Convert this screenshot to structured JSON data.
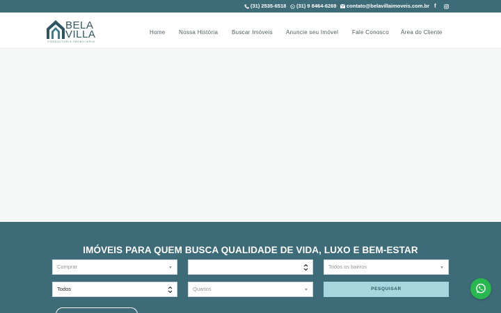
{
  "topbar": {
    "phone": "(31) 2535-6518",
    "whatsapp": "(31) 9 8464-6269",
    "email": "contato@belavillaimoveis.com.br",
    "facebook_glyph": "f"
  },
  "logo": {
    "line1": "BELA",
    "line2": "VILLA",
    "tagline": "CONSULTORIA IMOBILIÁRIA"
  },
  "nav": {
    "items": [
      "Home",
      "Nossa História",
      "Buscar Imóveis",
      "Anuncie seu Imóvel",
      "Fale Conosco",
      "Área do Cliente"
    ]
  },
  "search": {
    "heading": "IMÓVEIS PARA QUEM BUSCA QUALIDADE DE VIDA, LUXO E BEM-ESTAR",
    "purpose_placeholder": "Comprar",
    "city_value": "",
    "neighborhood_placeholder": "Todos os bairros",
    "type_value": "Todos",
    "rooms_placeholder": "Quartos",
    "submit_label": "PESQUISAR"
  },
  "colors": {
    "brand_teal": "#3d6b78",
    "button_light": "#a6d7df",
    "whatsapp_green": "#29b84f"
  },
  "icons": {
    "phone": "phone-icon",
    "whatsapp": "whatsapp-icon",
    "email": "envelope-icon",
    "facebook": "facebook-icon",
    "instagram": "instagram-icon"
  }
}
